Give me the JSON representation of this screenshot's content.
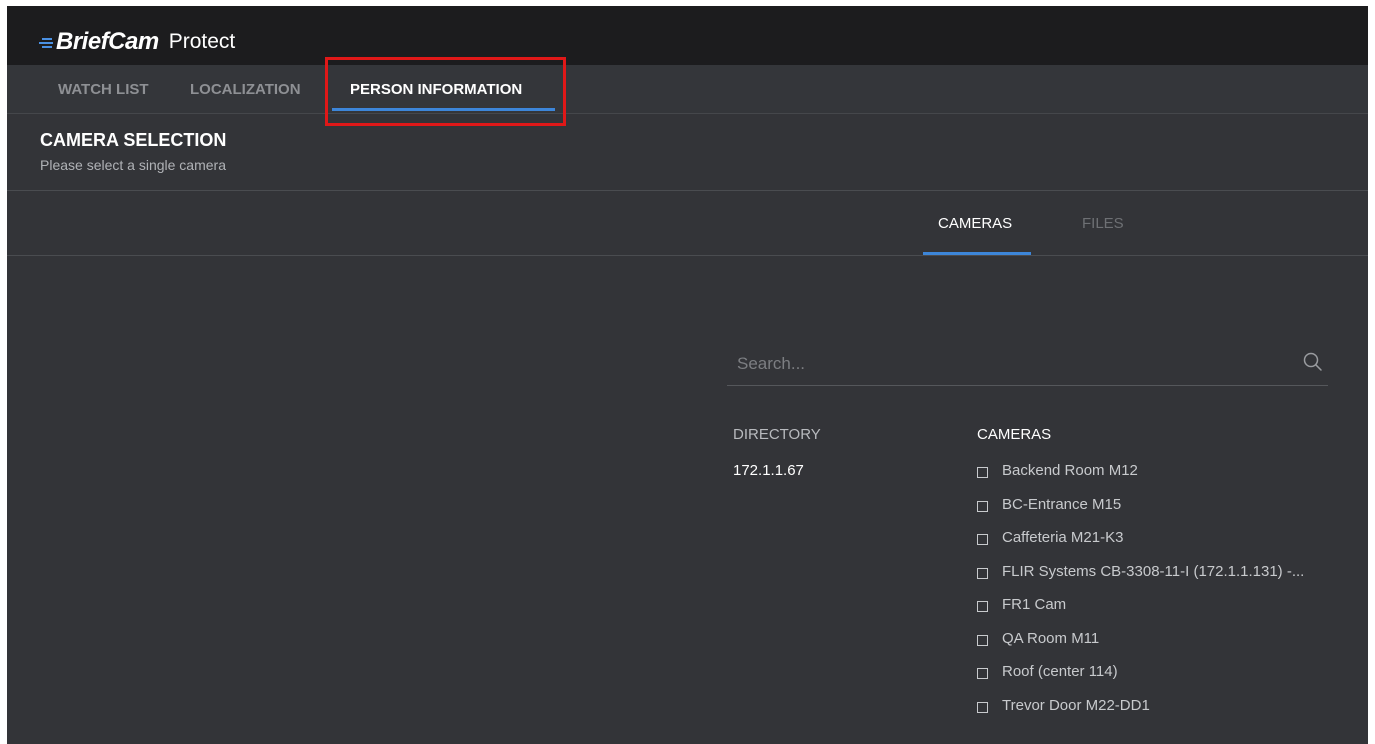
{
  "app": {
    "brand": "BriefCam",
    "product": "Protect"
  },
  "nav": {
    "tabs": [
      {
        "label": "WATCH LIST"
      },
      {
        "label": "LOCALIZATION"
      },
      {
        "label": "PERSON INFORMATION",
        "active": true
      }
    ]
  },
  "section": {
    "title": "CAMERA SELECTION",
    "subtitle": "Please select a single camera"
  },
  "subtabs": [
    {
      "label": "CAMERAS",
      "active": true
    },
    {
      "label": "FILES",
      "active": false
    }
  ],
  "search": {
    "placeholder": "Search...",
    "icon": "search-icon"
  },
  "directory": {
    "header": "DIRECTORY",
    "items": [
      "172.1.1.67"
    ]
  },
  "cameras": {
    "header": "CAMERAS",
    "items": [
      {
        "label": "Backend Room M12",
        "checked": false
      },
      {
        "label": "BC-Entrance M15",
        "checked": false
      },
      {
        "label": "Caffeteria M21-K3",
        "checked": false
      },
      {
        "label": "FLIR Systems CB-3308-11-I (172.1.1.131) -...",
        "checked": false
      },
      {
        "label": "FR1 Cam",
        "checked": false
      },
      {
        "label": "QA Room M11",
        "checked": false
      },
      {
        "label": "Roof (center 114)",
        "checked": false
      },
      {
        "label": "Trevor Door M22-DD1",
        "checked": false
      }
    ]
  },
  "colors": {
    "accent": "#3d86d9",
    "highlight": "#e01818",
    "background": "#333438",
    "topbar": "#1c1c1e"
  }
}
